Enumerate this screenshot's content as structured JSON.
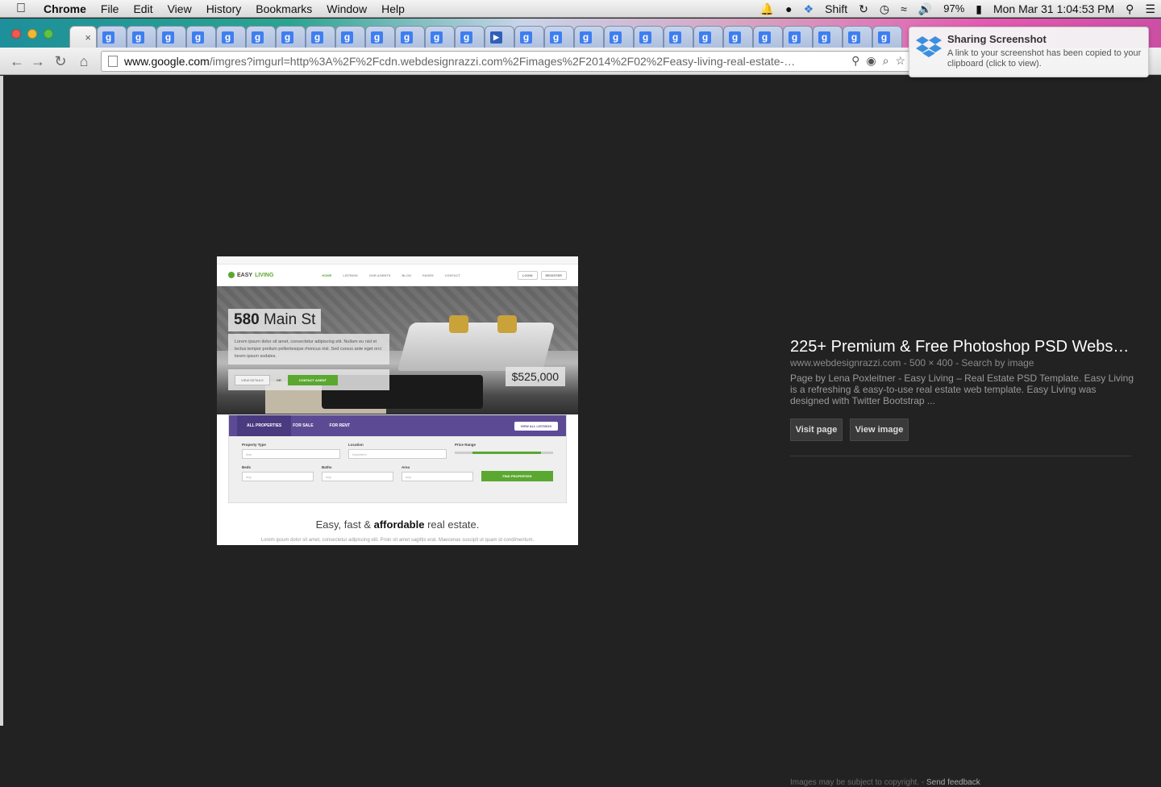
{
  "menubar": {
    "app_name": "Chrome",
    "menus": [
      "File",
      "Edit",
      "View",
      "History",
      "Bookmarks",
      "Window",
      "Help"
    ],
    "status": {
      "shift_label": "Shift",
      "battery": "97%",
      "clock": "Mon Mar 31  1:04:53 PM"
    }
  },
  "tabs": {
    "favicon_letter": "g",
    "count": 27,
    "active_close": "×"
  },
  "toolbar": {
    "url_host": "www.google.com",
    "url_rest": "/imgres?imgurl=http%3A%2F%2Fcdn.webdesignrazzi.com%2Fimages%2F2014%2F02%2Feasy-living-real-estate-…"
  },
  "notification": {
    "title": "Sharing Screenshot",
    "body": "A link to your screenshot has been copied to your clipboard (click to view)."
  },
  "preview": {
    "logo_easy": "EASY",
    "logo_living": "LIVING",
    "nav": [
      "HOME",
      "LISTINGS",
      "OUR AGENTS",
      "BLOG",
      "PAGES",
      "CONTACT"
    ],
    "login": "LOGIN",
    "register": "REGISTER",
    "address_number": "580",
    "address_street": " Main St",
    "description": "Lorem ipsum dolor sit amet, consectetur adipiscing elit. Nullam eu nisl et lectus tempor pretium pellentesque rhoncus nisl. Sed cursus ante eget orci lorem ipsum sodales.",
    "view_details": "VIEW DETAILS",
    "or": "OR",
    "contact_agent": "CONTACT AGENT",
    "price": "$525,000",
    "search_tabs": [
      "ALL PROPERTIES",
      "FOR SALE",
      "FOR RENT"
    ],
    "view_all": "VIEW ALL LISTINGS",
    "fields": {
      "property_type": {
        "label": "Property Type",
        "value": "Any"
      },
      "location": {
        "label": "Location",
        "value": "Anywhere"
      },
      "price_range": {
        "label": "Price Range"
      },
      "beds": {
        "label": "Beds",
        "value": "Any"
      },
      "baths": {
        "label": "Baths",
        "value": "Any"
      },
      "area": {
        "label": "Area",
        "value": "Any"
      }
    },
    "find_properties": "FIND PROPERTIES",
    "tagline_start": "Easy, fast & ",
    "tagline_bold": "affordable",
    "tagline_end": " real estate.",
    "lorem_footer": "Lorem ipsum dolor sit amet, consectetur adipiscing elit. Proin sit amet sagittis erat. Maecenas suscipit ut quam id condimentum."
  },
  "info": {
    "title": "225+ Premium & Free Photoshop PSD Webs…",
    "meta": "www.webdesignrazzi.com - 500 × 400 - Search by image",
    "description": "Page by Lena Poxleitner - Easy Living – Real Estate PSD Template. Easy Living is a refreshing & easy-to-use real estate web template. Easy Living was designed with Twitter Bootstrap ...",
    "visit_page": "Visit page",
    "view_image": "View image"
  },
  "footer": {
    "copyright": "Images may be subject to copyright. - ",
    "send_feedback": "Send feedback"
  }
}
